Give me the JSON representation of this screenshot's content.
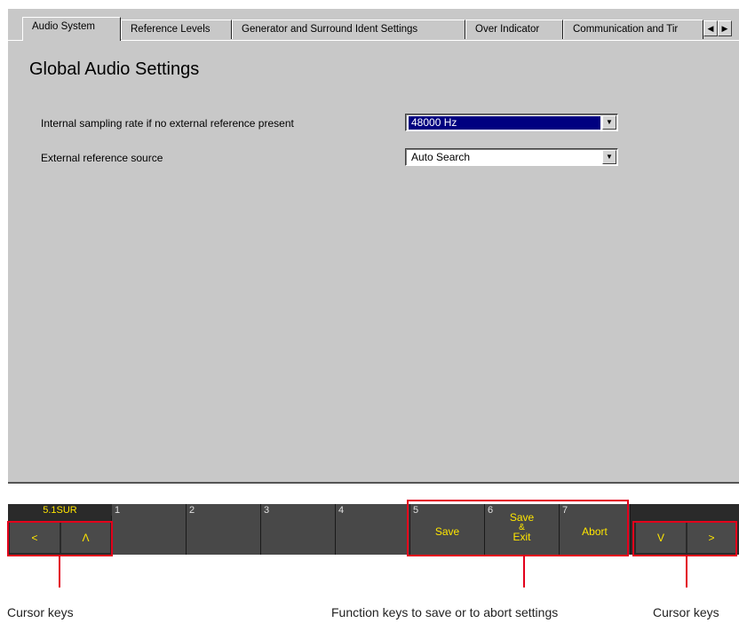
{
  "tabs": [
    {
      "label": "Audio System",
      "active": true
    },
    {
      "label": "Reference Levels",
      "active": false
    },
    {
      "label": "Generator and Surround Ident Settings",
      "active": false
    },
    {
      "label": "Over Indicator",
      "active": false
    },
    {
      "label": "Communication and Tir",
      "active": false
    }
  ],
  "scroll": {
    "left": "◀",
    "right": "▶"
  },
  "page_title": "Global Audio Settings",
  "settings": [
    {
      "label": "Internal sampling rate if no external reference present",
      "value": "48000 Hz"
    },
    {
      "label": "External reference source",
      "value": "Auto Search"
    }
  ],
  "dropdown_arrow": "▼",
  "status": {
    "mode": "5.1SUR"
  },
  "keys": {
    "left_cursor": "<",
    "up_cursor": "Λ",
    "k1": "1",
    "k2": "2",
    "k3": "3",
    "k4": "4",
    "k5_num": "5",
    "k5_label": "Save",
    "k6_num": "6",
    "k6_label_1": "Save",
    "k6_label_2": "&",
    "k6_label_3": "Exit",
    "k7_num": "7",
    "k7_label": "Abort",
    "down_cursor": "V",
    "right_cursor": ">"
  },
  "captions": {
    "left": "Cursor keys",
    "middle": "Function keys to save or to abort settings",
    "right": "Cursor keys"
  },
  "colors": {
    "highlight": "#e3001b",
    "key_text": "#ffe600",
    "selection": "#000080"
  }
}
